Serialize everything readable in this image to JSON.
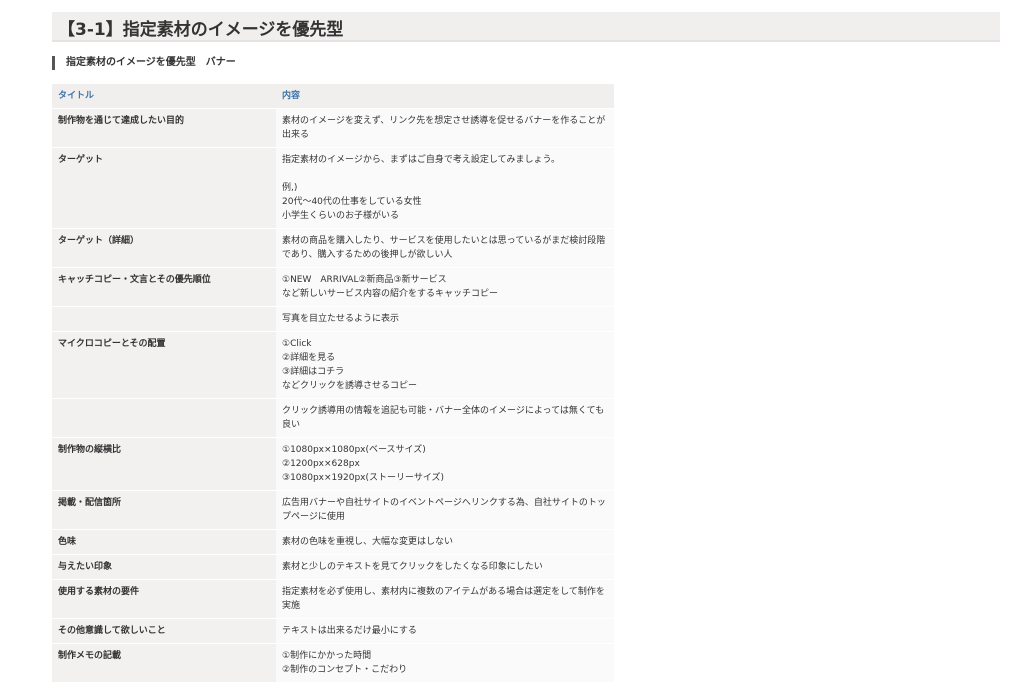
{
  "page_title": "【3-1】指定素材のイメージを優先型",
  "section_heading": "指定素材のイメージを優先型　バナー",
  "table": {
    "headers": [
      "タイトル",
      "内容"
    ],
    "rows": [
      {
        "label": "制作物を通じて達成したい目的",
        "content": [
          "素材のイメージを変えず、リンク先を想定させ誘導を促せるバナーを作ることが出来る"
        ]
      },
      {
        "label": "ターゲット",
        "content": [
          "指定素材のイメージから、まずはご自身で考え設定してみましょう。",
          "",
          "例,)",
          "20代〜40代の仕事をしている女性",
          "小学生くらいのお子様がいる"
        ]
      },
      {
        "label": "ターゲット（詳細）",
        "content": [
          "素材の商品を購入したり、サービスを使用したいとは思っているがまだ検討段階であり、購入するための後押しが欲しい人"
        ]
      },
      {
        "label": "キャッチコピー・文言とその優先順位",
        "content": [
          "①NEW　ARRIVAL②新商品③新サービス",
          "など新しいサービス内容の紹介をするキャッチコピー"
        ]
      },
      {
        "label": "",
        "content": [
          "写真を目立たせるように表示"
        ]
      },
      {
        "label": "マイクロコピーとその配置",
        "content": [
          "①Click",
          "②詳細を見る",
          "③詳細はコチラ",
          "などクリックを誘導させるコピー"
        ]
      },
      {
        "label": "",
        "content": [
          "クリック誘導用の情報を追記も可能・バナー全体のイメージによっては無くても良い"
        ]
      },
      {
        "label": "制作物の縦横比",
        "content": [
          "①1080px×1080px(ベースサイズ)",
          "②1200px×628px",
          "③1080px×1920px(ストーリーサイズ)"
        ]
      },
      {
        "label": "掲載・配信箇所",
        "content": [
          "広告用バナーや自社サイトのイベントページへリンクする為、自社サイトのトップページに使用"
        ]
      },
      {
        "label": "色味",
        "content": [
          "素材の色味を重視し、大幅な変更はしない"
        ]
      },
      {
        "label": "与えたい印象",
        "content": [
          "素材と少しのテキストを見てクリックをしたくなる印象にしたい"
        ]
      },
      {
        "label": "使用する素材の要件",
        "content": [
          "指定素材を必ず使用し、素材内に複数のアイテムがある場合は選定をして制作を実施"
        ]
      },
      {
        "label": "その他意識して欲しいこと",
        "content": [
          "テキストは出来るだけ最小にする"
        ]
      },
      {
        "label": "制作メモの記載",
        "content": [
          "①制作にかかった時間",
          "②制作のコンセプト・こだわり"
        ]
      }
    ]
  }
}
